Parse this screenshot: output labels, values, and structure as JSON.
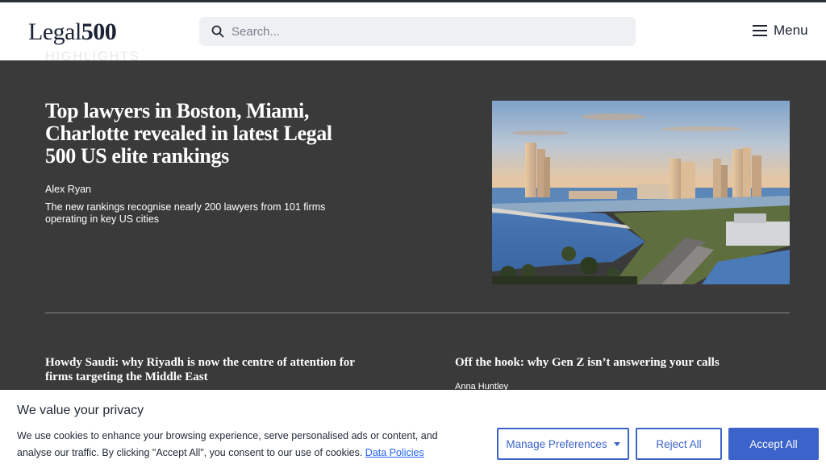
{
  "header": {
    "logo_text": "Legal",
    "logo_number": "500",
    "search_placeholder": "Search...",
    "menu_label": "Menu"
  },
  "section": {
    "label": "HIGHLIGHTS"
  },
  "hero": {
    "title": "Top lawyers in Boston, Miami, Charlotte revealed in latest Legal 500 US elite rankings",
    "author": "Alex Ryan",
    "description": "The new rankings recognise nearly 200 lawyers from 101 firms operating in key US cities",
    "image_subject": "Miami skyline with causeway and bay"
  },
  "articles": [
    {
      "title": "Howdy Saudi: why Riyadh is now the centre of attention for firms targeting the Middle East"
    },
    {
      "title": "Off the hook: why Gen Z isn’t answering your calls",
      "author": "Anna Huntley"
    }
  ],
  "cookie": {
    "title": "We value your privacy",
    "text": "We use cookies to enhance your browsing experience, serve personalised ads or content, and analyse our traffic. By clicking \"Accept All\", you consent to our use of cookies.",
    "link": "Data Policies",
    "manage_label": "Manage Preferences",
    "reject_label": "Reject All",
    "accept_label": "Accept All"
  },
  "colors": {
    "background": "#3a3a3a",
    "accent": "#3b63c9",
    "brand_navy": "#1a2233"
  }
}
